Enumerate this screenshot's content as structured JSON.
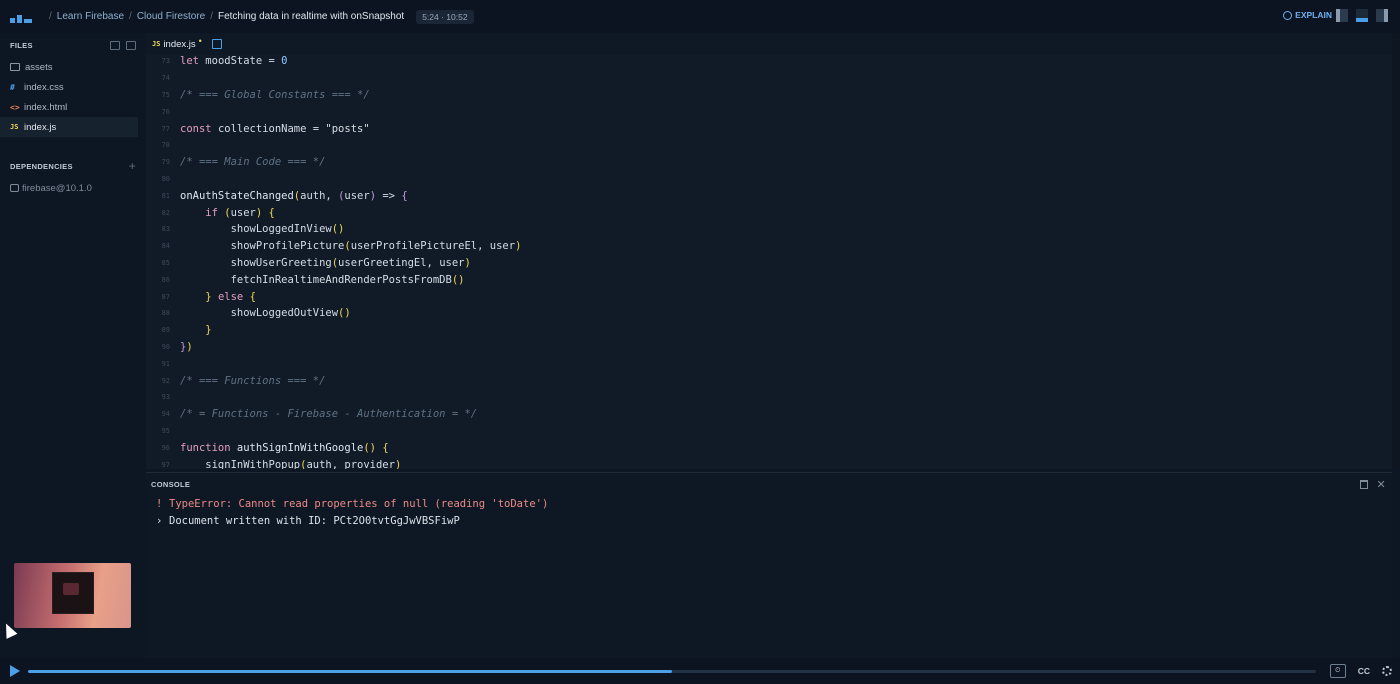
{
  "topbar": {
    "breadcrumbs": [
      "Learn Firebase",
      "Cloud Firestore",
      "Fetching data in realtime with onSnapshot"
    ],
    "timer": "5:24 · 10:52",
    "explain_label": "EXPLAIN"
  },
  "sidebar": {
    "files_heading": "FILES",
    "files": [
      {
        "icon": "folder-icon",
        "label": "assets"
      },
      {
        "icon": "css-file-icon",
        "glyph": "#",
        "label": "index.css"
      },
      {
        "icon": "html-file-icon",
        "glyph": "<>",
        "label": "index.html"
      },
      {
        "icon": "js-file-icon",
        "glyph": "JS",
        "label": "index.js",
        "active": true
      }
    ],
    "dependencies_heading": "DEPENDENCIES",
    "dependencies": [
      "firebase@10.1.0"
    ]
  },
  "editor": {
    "tab_label": "index.js",
    "tab_glyph": "JS",
    "lines": [
      {
        "n": "73",
        "tokens": [
          [
            "kw",
            "let "
          ],
          [
            "txt",
            "moodState = "
          ],
          [
            "num",
            "0"
          ]
        ]
      },
      {
        "n": "74",
        "tokens": []
      },
      {
        "n": "75",
        "tokens": [
          [
            "cm",
            "/* === Global Constants === */"
          ]
        ]
      },
      {
        "n": "76",
        "tokens": []
      },
      {
        "n": "77",
        "tokens": [
          [
            "kw",
            "const "
          ],
          [
            "txt",
            "collectionName = "
          ],
          [
            "str",
            "\"posts\""
          ]
        ]
      },
      {
        "n": "78",
        "tokens": []
      },
      {
        "n": "79",
        "tokens": [
          [
            "cm",
            "/* === Main Code === */"
          ]
        ]
      },
      {
        "n": "80",
        "tokens": []
      },
      {
        "n": "81",
        "tokens": [
          [
            "fn",
            "onAuthStateChanged"
          ],
          [
            "pa",
            "("
          ],
          [
            "txt",
            "auth, "
          ],
          [
            "br",
            "("
          ],
          [
            "txt",
            "user"
          ],
          [
            "br",
            ")"
          ],
          [
            "txt",
            " => "
          ],
          [
            "br",
            "{"
          ]
        ]
      },
      {
        "n": "82",
        "tokens": [
          [
            "txt",
            "    "
          ],
          [
            "kw",
            "if "
          ],
          [
            "pa",
            "("
          ],
          [
            "txt",
            "user"
          ],
          [
            "pa",
            ")"
          ],
          [
            "txt",
            " "
          ],
          [
            "pa",
            "{"
          ]
        ]
      },
      {
        "n": "83",
        "tokens": [
          [
            "txt",
            "        showLoggedInView"
          ],
          [
            "pa",
            "()"
          ]
        ]
      },
      {
        "n": "84",
        "tokens": [
          [
            "txt",
            "        showProfilePicture"
          ],
          [
            "pa",
            "("
          ],
          [
            "txt",
            "userProfilePictureEl, user"
          ],
          [
            "pa",
            ")"
          ]
        ]
      },
      {
        "n": "85",
        "tokens": [
          [
            "txt",
            "        showUserGreeting"
          ],
          [
            "pa",
            "("
          ],
          [
            "txt",
            "userGreetingEl, user"
          ],
          [
            "pa",
            ")"
          ]
        ]
      },
      {
        "n": "86",
        "tokens": [
          [
            "txt",
            "        fetchInRealtimeAndRenderPostsFromDB"
          ],
          [
            "pa",
            "()"
          ]
        ]
      },
      {
        "n": "87",
        "tokens": [
          [
            "txt",
            "    "
          ],
          [
            "pa",
            "}"
          ],
          [
            "kw",
            " else "
          ],
          [
            "pa",
            "{"
          ]
        ]
      },
      {
        "n": "88",
        "tokens": [
          [
            "txt",
            "        showLoggedOutView"
          ],
          [
            "pa",
            "()"
          ]
        ]
      },
      {
        "n": "89",
        "tokens": [
          [
            "txt",
            "    "
          ],
          [
            "pa",
            "}"
          ]
        ]
      },
      {
        "n": "90",
        "tokens": [
          [
            "br",
            "}"
          ],
          [
            "pa",
            ")"
          ]
        ]
      },
      {
        "n": "91",
        "tokens": []
      },
      {
        "n": "92",
        "tokens": [
          [
            "cm",
            "/* === Functions === */"
          ]
        ]
      },
      {
        "n": "93",
        "tokens": []
      },
      {
        "n": "94",
        "tokens": [
          [
            "cm",
            "/* = Functions - Firebase - Authentication = */"
          ]
        ]
      },
      {
        "n": "95",
        "tokens": []
      },
      {
        "n": "96",
        "tokens": [
          [
            "kw",
            "function "
          ],
          [
            "fn",
            "authSignInWithGoogle"
          ],
          [
            "pa",
            "()"
          ],
          [
            "txt",
            " "
          ],
          [
            "pa",
            "{"
          ]
        ]
      },
      {
        "n": "97",
        "tokens": [
          [
            "txt",
            "    signInWithPopup"
          ],
          [
            "pa",
            "("
          ],
          [
            "txt",
            "auth, provider"
          ],
          [
            "pa",
            ")"
          ]
        ]
      }
    ]
  },
  "console": {
    "heading": "CONSOLE",
    "lines": [
      {
        "type": "err",
        "prefix": "!",
        "text": "TypeError: Cannot read properties of null (reading 'toDate')"
      },
      {
        "type": "log",
        "prefix": "›",
        "text": "Document written with ID: PCt2O0tvtGgJwVBSFiwP"
      }
    ]
  },
  "player": {
    "progress": 0.5,
    "speed_label": "1x",
    "cc_label": "CC"
  },
  "colors": {
    "accent": "#4a9fe8",
    "error": "#ec8b86",
    "background": "#0d1623"
  }
}
